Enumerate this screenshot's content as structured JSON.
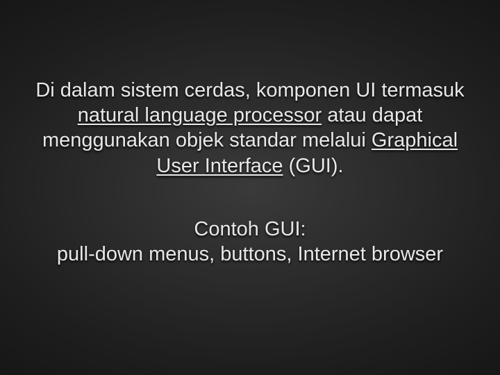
{
  "paragraph1": {
    "t1": "Di dalam sistem cerdas, komponen UI termasuk ",
    "u1": "natural language processor",
    "t2": " atau dapat menggunakan objek standar melalui ",
    "u2": "Graphical User Interface",
    "t3": " (GUI)."
  },
  "paragraph2": {
    "line1": "Contoh GUI:",
    "line2": "pull-down menus, buttons, Internet browser"
  }
}
